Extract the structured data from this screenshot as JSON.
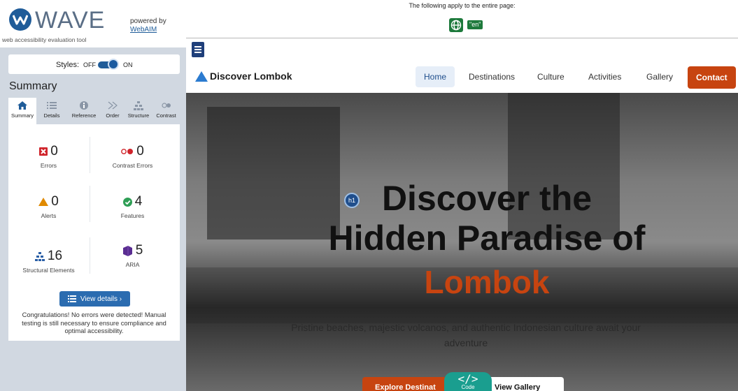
{
  "wave": {
    "wordmark": "WAVE",
    "tagline": "web accessibility evaluation tool",
    "powered_by": "powered by",
    "webaim_link": "WebAIM",
    "styles": {
      "label": "Styles:",
      "off": "OFF",
      "on": "ON",
      "state": "on"
    },
    "summary_heading": "Summary",
    "tabs": [
      {
        "label": "Summary",
        "icon": "home-icon",
        "active": true
      },
      {
        "label": "Details",
        "icon": "list-icon",
        "active": false
      },
      {
        "label": "Reference",
        "icon": "info-icon",
        "active": false
      },
      {
        "label": "Order",
        "icon": "order-icon",
        "active": false
      },
      {
        "label": "Structure",
        "icon": "structure-icon",
        "active": false
      },
      {
        "label": "Contrast",
        "icon": "contrast-icon",
        "active": false
      }
    ],
    "stats": {
      "errors": {
        "count": "0",
        "label": "Errors",
        "icon": "error-icon"
      },
      "contrast_errors": {
        "count": "0",
        "label": "Contrast Errors",
        "icon": "contrast-error-icon"
      },
      "alerts": {
        "count": "0",
        "label": "Alerts",
        "icon": "alert-icon"
      },
      "features": {
        "count": "4",
        "label": "Features",
        "icon": "feature-check-icon"
      },
      "structural": {
        "count": "16",
        "label": "Structural Elements",
        "icon": "structure-icon"
      },
      "aria": {
        "count": "5",
        "label": "ARIA",
        "icon": "aria-icon"
      }
    },
    "view_details": "View details ›",
    "congrats": "Congratulations! No errors were detected! Manual testing is still necessary to ensure compliance and optimal accessibility."
  },
  "page": {
    "lang_note": "The following apply to the entire page:",
    "lang_badge": "\"en\"",
    "site_name": "Discover Lombok",
    "nav": [
      "Home",
      "Destinations",
      "Culture",
      "Activities",
      "Gallery",
      "Contact"
    ],
    "hero": {
      "h1_badge": "h1",
      "title_line1": "Discover the",
      "title_line2": "Hidden Paradise of",
      "title_line3": "Lombok",
      "subtitle": "Pristine beaches, majestic volcanos, and authentic Indonesian culture await your adventure"
    },
    "explore_btn": "Explore Destinat",
    "gallery_btn": "View Gallery",
    "code_btn": {
      "glyph": "</>",
      "label": "Code"
    },
    "colors": {
      "accent": "#c74410",
      "wave_blue": "#1f5c99",
      "badge_green": "#1e7a3c"
    }
  }
}
